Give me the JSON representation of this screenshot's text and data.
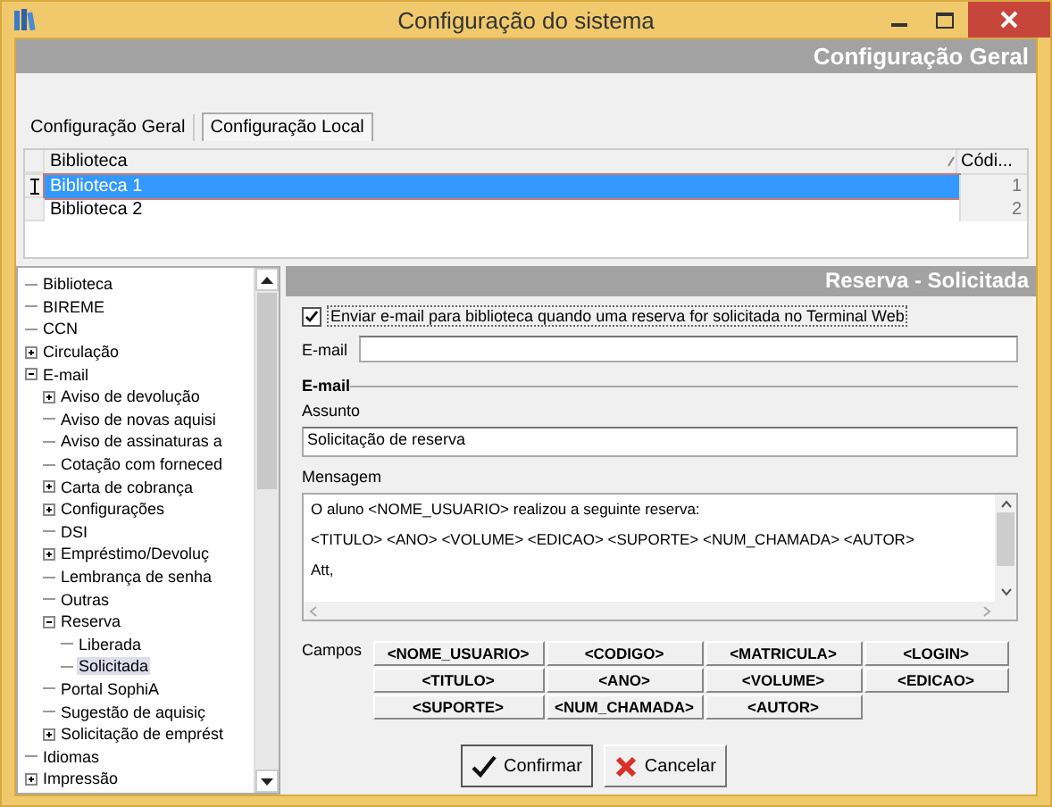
{
  "window": {
    "title": "Configuração do sistema"
  },
  "header": {
    "title": "Configuração Geral"
  },
  "tabs": [
    {
      "label": "Configuração Geral",
      "selected": false
    },
    {
      "label": "Configuração Local",
      "selected": true
    }
  ],
  "grid": {
    "columns": [
      "Biblioteca",
      "Códi..."
    ],
    "rows": [
      {
        "cells": [
          "Biblioteca 1",
          "1"
        ],
        "selected": true
      },
      {
        "cells": [
          "Biblioteca 2",
          "2"
        ],
        "selected": false
      }
    ]
  },
  "tree": [
    {
      "label": "Biblioteca"
    },
    {
      "label": "BIREME"
    },
    {
      "label": "CCN"
    },
    {
      "label": "Circulação",
      "expanded": false
    },
    {
      "label": "E-mail",
      "expanded": true,
      "children": [
        {
          "label": "Aviso de devolução",
          "expanded": false
        },
        {
          "label": "Aviso de novas aquisi"
        },
        {
          "label": "Aviso de assinaturas a"
        },
        {
          "label": "Cotação com forneced"
        },
        {
          "label": "Carta de cobrança",
          "expanded": false
        },
        {
          "label": "Configurações",
          "expanded": false
        },
        {
          "label": "DSI"
        },
        {
          "label": "Empréstimo/Devoluç",
          "expanded": false
        },
        {
          "label": "Lembrança de senha"
        },
        {
          "label": "Outras"
        },
        {
          "label": "Reserva",
          "expanded": true,
          "children": [
            {
              "label": "Liberada",
              "selected": false
            },
            {
              "label": "Solicitada",
              "selected": true
            }
          ]
        },
        {
          "label": "Portal SophiA"
        },
        {
          "label": "Sugestão de aquisiç"
        },
        {
          "label": "Solicitação de emprést",
          "expanded": false
        }
      ]
    },
    {
      "label": "Idiomas"
    },
    {
      "label": "Impressão",
      "expanded": false
    }
  ],
  "panel": {
    "title": "Reserva - Solicitada",
    "notify": {
      "label": "Enviar e-mail para biblioteca quando uma reserva for solicitada no Terminal Web",
      "checked": true
    },
    "email": {
      "label": "E-mail"
    },
    "group_label": "E-mail",
    "subject": {
      "label": "Assunto",
      "value": "Solicitação de reserva"
    },
    "message": {
      "label": "Mensagem",
      "lines": [
        "O aluno <NOME_USUARIO> realizou a seguinte reserva:",
        "<TITULO> <ANO> <VOLUME> <EDICAO> <SUPORTE> <NUM_CHAMADA> <AUTOR>",
        "Att,"
      ]
    },
    "fields_label": "Campos",
    "field_buttons": [
      "<NOME_USUARIO>",
      "<CODIGO>",
      "<MATRICULA>",
      "<LOGIN>",
      "<TITULO>",
      "<ANO>",
      "<VOLUME>",
      "<EDICAO>",
      "<SUPORTE>",
      "<NUM_CHAMADA>",
      "<AUTOR>"
    ]
  },
  "buttons": [
    {
      "label": "Confirmar",
      "kind": "confirm"
    },
    {
      "label": "Cancelar",
      "kind": "cancel"
    }
  ]
}
